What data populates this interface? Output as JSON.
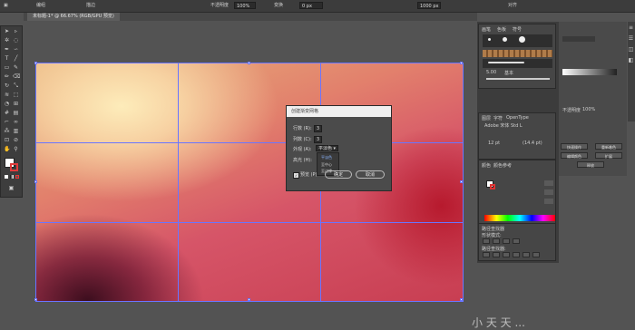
{
  "control_bar": {
    "items": [
      "编组",
      "描边",
      "不透明度",
      "变换",
      "对齐"
    ],
    "opacity_value": "100%",
    "x_value": "0 px",
    "y_value": "1000 px"
  },
  "document_tab": "未标题-1* @ 66.67% (RGB/GPU 预览)",
  "dialog": {
    "title": "创建渐变网格",
    "rows_label": "行数 (R):",
    "rows_value": "3",
    "cols_label": "列数 (C):",
    "cols_value": "3",
    "appearance_label": "外观 (A):",
    "appearance_value": "平淡色",
    "highlight_label": "高光 (H):",
    "dropdown_options": [
      "平淡色",
      "至中心",
      "至边缘"
    ],
    "preview_label": "预览 (P)",
    "ok_label": "确定",
    "cancel_label": "取消"
  },
  "panels": {
    "brushes_tabs": [
      "画笔",
      "色板",
      "符号"
    ],
    "brush_size_label": "5.00",
    "basic_label": "基本",
    "layers_tabs": [
      "图层",
      "字符",
      "OpenType"
    ],
    "char_font": "Adobe 宋体 Std L",
    "font_size": "12 pt",
    "leading": "(14.4 pt)",
    "color_tabs": [
      "颜色",
      "颜色参考"
    ],
    "pathfinder_title": "路径查找器",
    "shape_modes_title": "形状模式:",
    "pathfinder_label": "路径查找器:",
    "right_opacity": "100%",
    "opacity_label": "不透明度",
    "right_buttons": [
      "快速操作",
      "重新着色",
      "编辑颜色",
      "扩展",
      "释放"
    ]
  },
  "colors": {
    "grid_line": "#6a75ff",
    "panel_bg": "#3c3c3c"
  },
  "watermark": "小 天 天 ..."
}
